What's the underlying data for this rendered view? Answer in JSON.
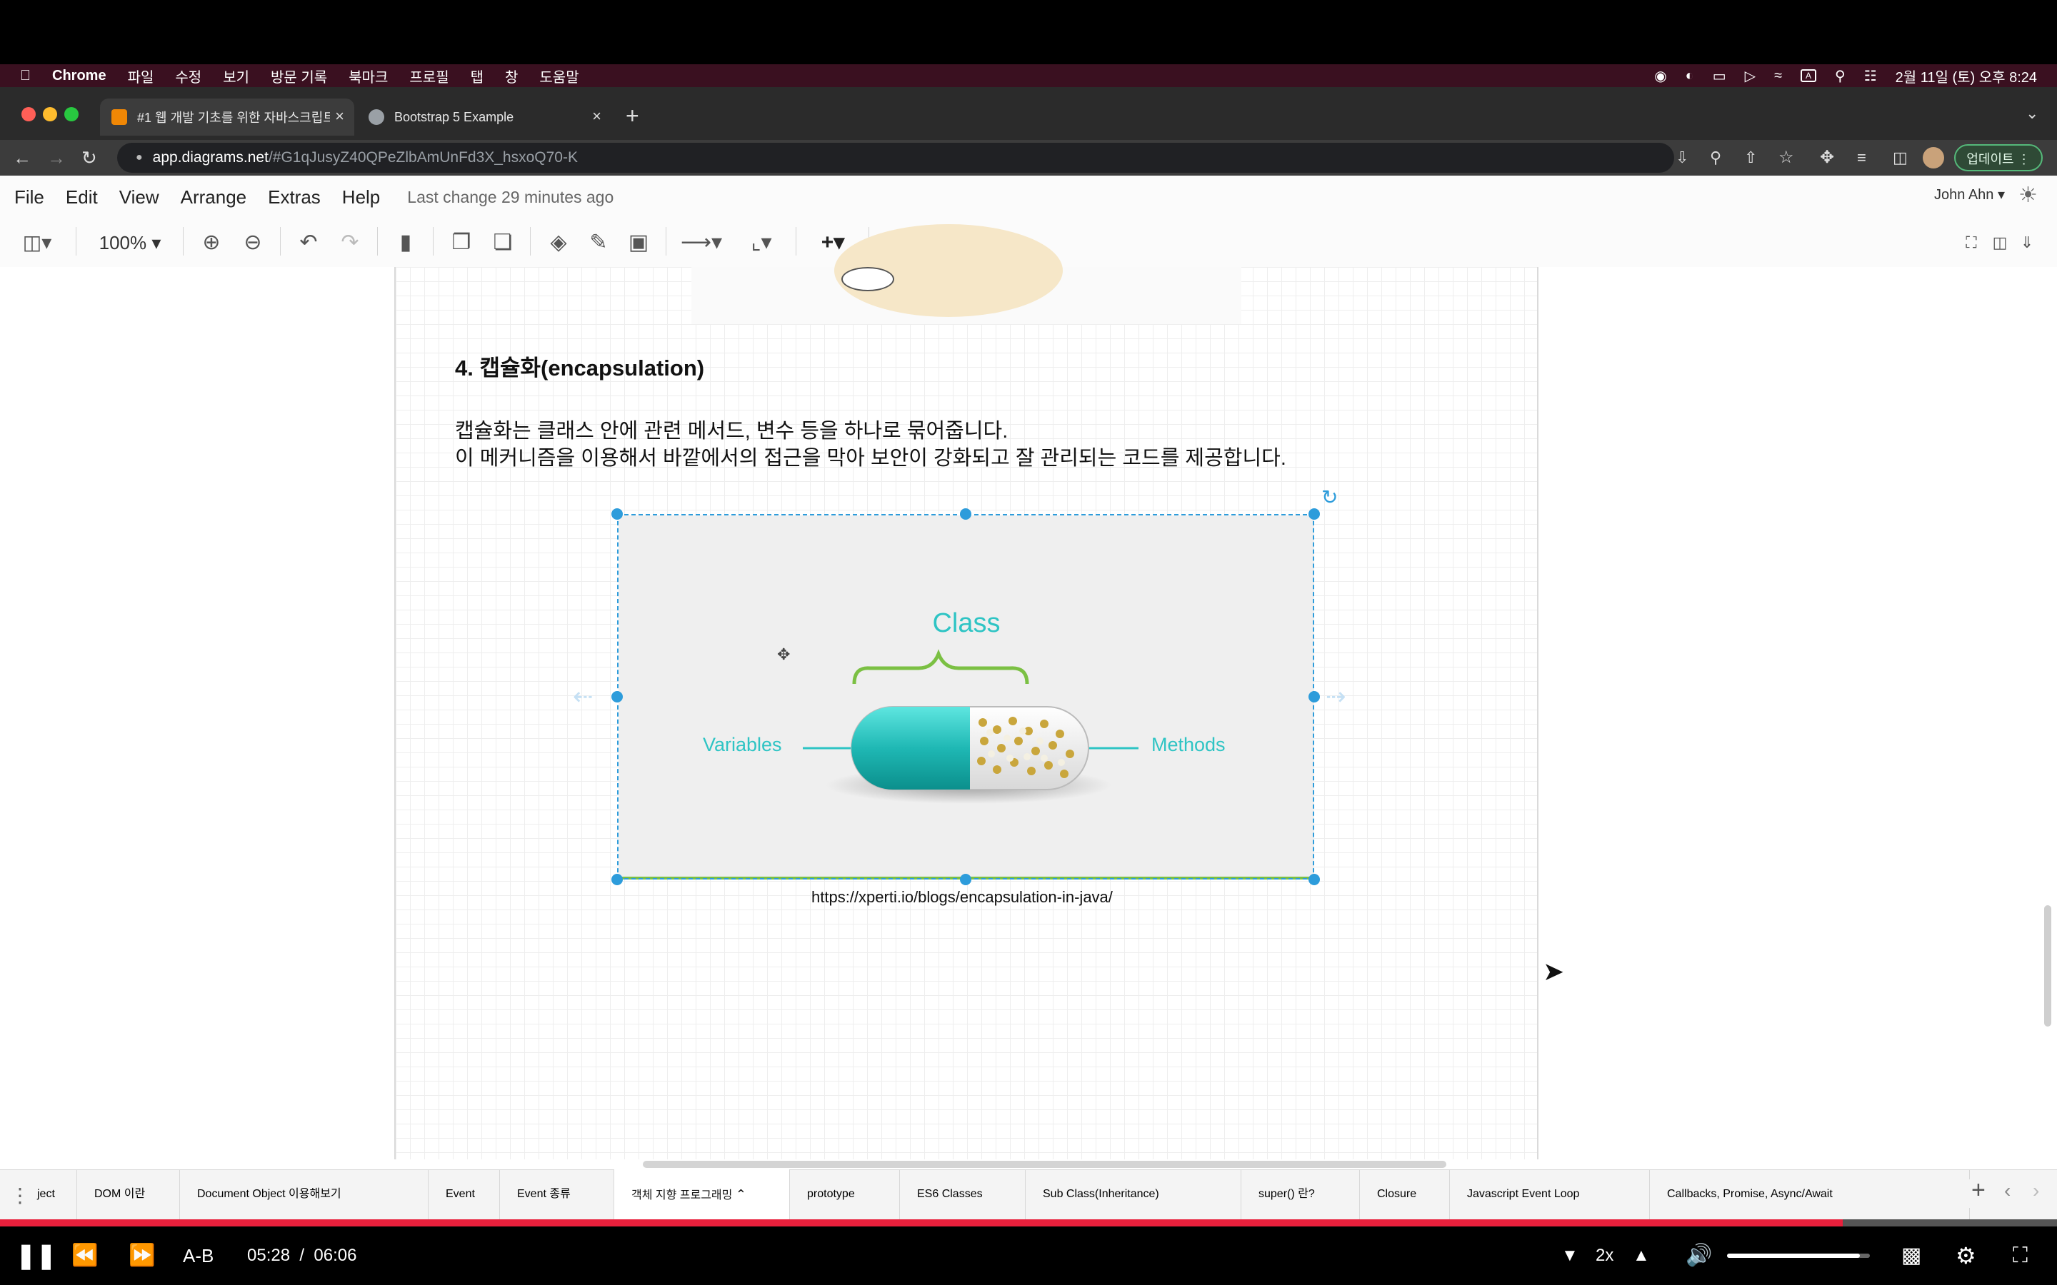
{
  "menubar": {
    "app": "Chrome",
    "items": [
      "파일",
      "수정",
      "보기",
      "방문 기록",
      "북마크",
      "프로필",
      "탭",
      "창",
      "도움말"
    ],
    "clock": "2월 11일 (토) 오후 8:24",
    "input_indicator": "A"
  },
  "browser": {
    "tabs": [
      {
        "title": "#1 웹 개발 기초를 위한 자바스크립트",
        "active": true,
        "favicon_color": "#f08705"
      },
      {
        "title": "Bootstrap 5 Example",
        "active": false,
        "favicon_color": "#9aa0a6"
      }
    ],
    "url_host": "app.diagrams.net",
    "url_path": "/#G1qJusyZ40QPeZlbAmUnFd3X_hsxoQ70-K",
    "update_label": "업데이트"
  },
  "drawio": {
    "menu": [
      "File",
      "Edit",
      "View",
      "Arrange",
      "Extras",
      "Help"
    ],
    "last_change": "Last change 29 minutes ago",
    "user": "John Ahn",
    "zoom": "100%"
  },
  "content": {
    "heading": "4. 캡슐화(encapsulation)",
    "para1": "캡슐화는 클래스 안에 관련 메서드, 변수 등을 하나로 묶어줍니다.",
    "para2": "이 메커니즘을 이용해서 바깥에서의 접근을 막아 보안이 강화되고 잘 관리되는 코드를 제공합니다.",
    "diagram": {
      "class_label": "Class",
      "left_label": "Variables",
      "right_label": "Methods"
    },
    "caption": "https://xperti.io/blogs/encapsulation-in-java/"
  },
  "page_tabs": [
    {
      "label": "ject",
      "active": false
    },
    {
      "label": "DOM 이란",
      "active": false
    },
    {
      "label": "Document Object 이용해보기",
      "active": false
    },
    {
      "label": "Event",
      "active": false
    },
    {
      "label": "Event 종류",
      "active": false
    },
    {
      "label": "객체 지향 프로그래밍",
      "active": true
    },
    {
      "label": "prototype",
      "active": false
    },
    {
      "label": "ES6 Classes",
      "active": false
    },
    {
      "label": "Sub Class(Inheritance)",
      "active": false
    },
    {
      "label": "super() 란?",
      "active": false
    },
    {
      "label": "Closure",
      "active": false
    },
    {
      "label": "Javascript Event Loop",
      "active": false
    },
    {
      "label": "Callbacks, Promise, Async/Await",
      "active": false
    }
  ],
  "player": {
    "ab_label": "A-B",
    "current_time": "05:28",
    "separator": "/",
    "duration": "06:06",
    "speed": "2x",
    "progress_fraction": 0.896,
    "volume_fraction": 0.93
  },
  "colors": {
    "accent": "#2d9cdb",
    "teal": "#2ec4c4",
    "green_brace": "#7bc043",
    "progress_red": "#e8203c",
    "menubar": "#3a1020"
  }
}
